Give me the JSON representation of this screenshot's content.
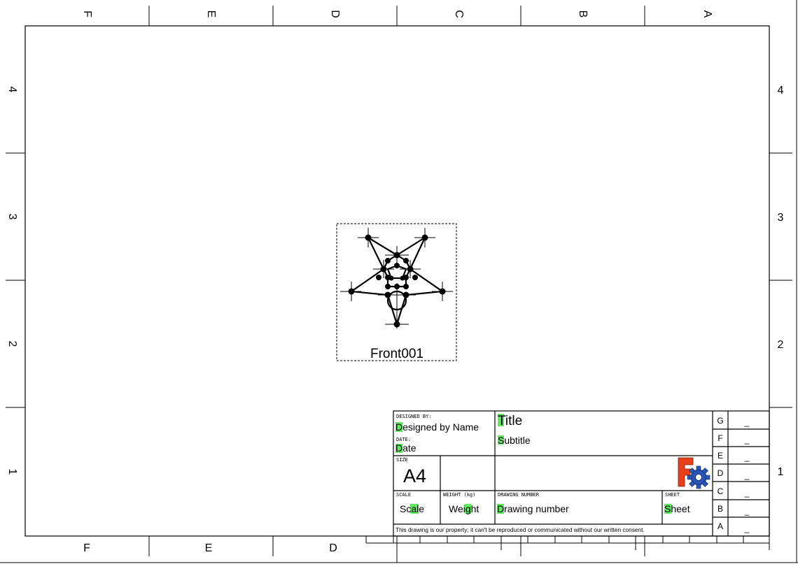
{
  "frame": {
    "columns_top": [
      "F",
      "E",
      "D",
      "C",
      "B",
      "A"
    ],
    "columns_bottom": [
      "F",
      "E",
      "D"
    ],
    "rows_left": [
      "4",
      "3",
      "2",
      "1"
    ],
    "rows_right": [
      "4",
      "3",
      "2",
      "1"
    ]
  },
  "view": {
    "label": "Front001"
  },
  "title_block": {
    "designed_by_label": "DESIGNED BY:",
    "designed_by_value": "Designed by Name",
    "date_label": "DATE:",
    "date_value": "Date",
    "size_label": "SIZE",
    "size_value": "A4",
    "scale_label": "SCALE",
    "scale_value": "Scale",
    "weight_label": "WEIGHT (kg)",
    "weight_value": "Weight",
    "title": "Title",
    "subtitle": "Subtitle",
    "drawing_number_label": "DRAWING NUMBER",
    "drawing_number_value": "Drawing number",
    "sheet_label": "SHEET",
    "sheet_value": "Sheet",
    "disclaimer": "This drawing is our property; it can't be reproduced or communicated without our written consent.",
    "revisions": [
      {
        "letter": "G",
        "value": "_"
      },
      {
        "letter": "F",
        "value": "_"
      },
      {
        "letter": "E",
        "value": "_"
      },
      {
        "letter": "D",
        "value": "_"
      },
      {
        "letter": "C",
        "value": "_"
      },
      {
        "letter": "B",
        "value": "_"
      },
      {
        "letter": "A",
        "value": "_"
      }
    ]
  },
  "colors": {
    "highlight": "#5ee85e",
    "logo_red": "#e8401c",
    "logo_blue": "#2a55b5"
  },
  "icons": {
    "logo": "freecad-logo-icon"
  }
}
